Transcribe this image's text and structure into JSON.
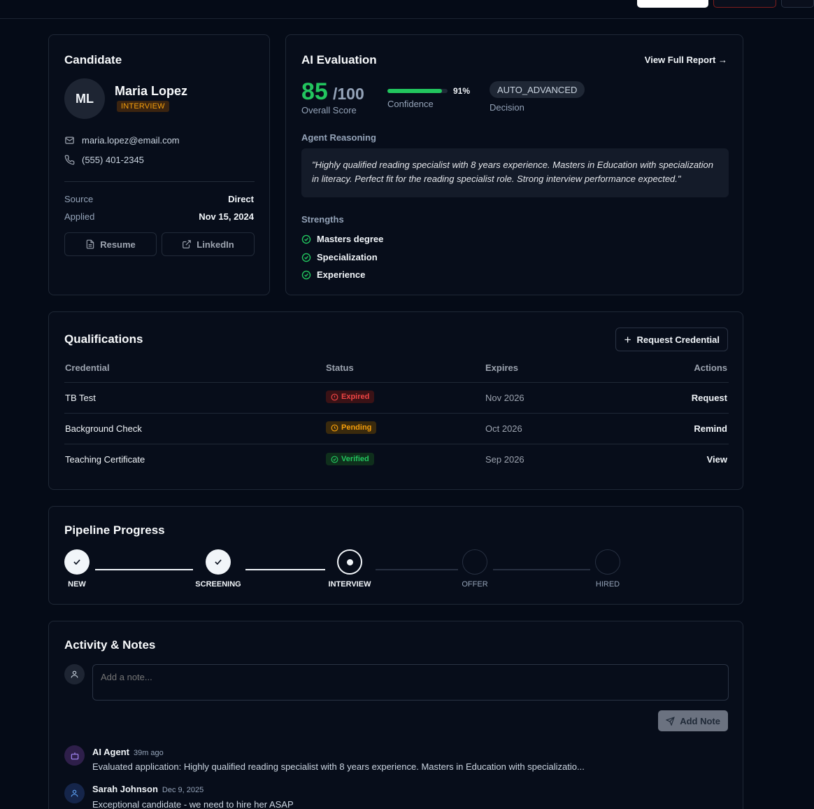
{
  "candidate": {
    "title": "Candidate",
    "initials": "ML",
    "name": "Maria Lopez",
    "stage": "INTERVIEW",
    "email": "maria.lopez@email.com",
    "phone": "(555) 401-2345",
    "source_label": "Source",
    "source_value": "Direct",
    "applied_label": "Applied",
    "applied_value": "Nov 15, 2024",
    "resume_label": "Resume",
    "linkedin_label": "LinkedIn"
  },
  "ai_eval": {
    "title": "AI Evaluation",
    "view_report": "View Full Report →",
    "score": "85",
    "score_max": "/100",
    "score_label": "Overall Score",
    "confidence_value": "91%",
    "confidence_fraction": 0.91,
    "confidence_label": "Confidence",
    "decision": "AUTO_ADVANCED",
    "decision_label": "Decision",
    "reasoning_label": "Agent Reasoning",
    "reasoning_text": "\"Highly qualified reading specialist with 8 years experience. Masters in Education with specialization in literacy. Perfect fit for the reading specialist role. Strong interview performance expected.\"",
    "strengths_label": "Strengths",
    "strengths": [
      "Masters degree",
      "Specialization",
      "Experience"
    ]
  },
  "qualifications": {
    "title": "Qualifications",
    "request_button": "Request Credential",
    "columns": [
      "Credential",
      "Status",
      "Expires",
      "Actions"
    ],
    "rows": [
      {
        "credential": "TB Test",
        "status": "Expired",
        "expires": "Nov 2026",
        "action": "Request"
      },
      {
        "credential": "Background Check",
        "status": "Pending",
        "expires": "Oct 2026",
        "action": "Remind"
      },
      {
        "credential": "Teaching Certificate",
        "status": "Verified",
        "expires": "Sep 2026",
        "action": "View"
      }
    ],
    "status_colors": {
      "Expired": "#ef4444",
      "Pending": "#f59e0b",
      "Verified": "#22c55e"
    }
  },
  "pipeline": {
    "title": "Pipeline Progress",
    "stages": [
      "NEW",
      "SCREENING",
      "INTERVIEW",
      "OFFER",
      "HIRED"
    ],
    "current_stage_index": 2
  },
  "activity": {
    "title": "Activity & Notes",
    "note_placeholder": "Add a note...",
    "add_note_label": "Add Note",
    "entries": [
      {
        "author": "AI Agent",
        "time": "39m ago",
        "text": "Evaluated application: Highly qualified reading specialist with 8 years experience. Masters in Education with specializatio..."
      },
      {
        "author": "Sarah Johnson",
        "time": "Dec 9, 2025",
        "text": "Exceptional candidate - we need to hire her ASAP"
      }
    ]
  },
  "colors": {
    "accent_green": "#22c55e",
    "stage_amber": "#f59e0b",
    "background": "#050b17"
  }
}
